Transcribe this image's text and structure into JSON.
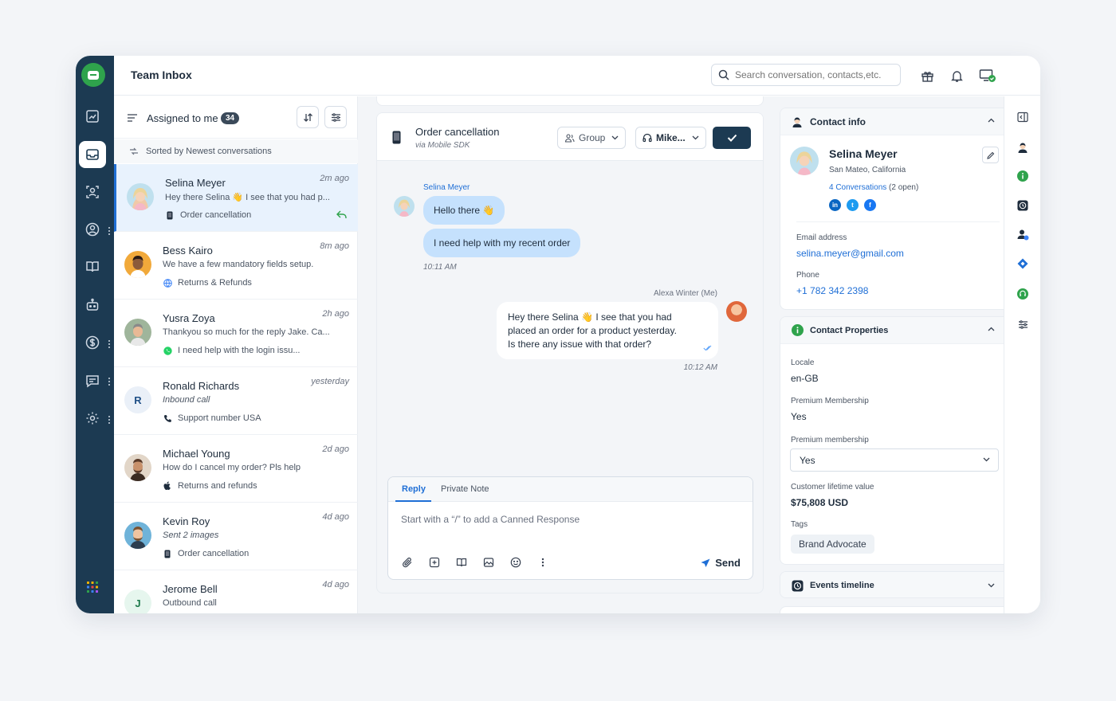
{
  "header": {
    "title": "Team Inbox",
    "search_placeholder": "Search conversation, contacts,etc."
  },
  "list": {
    "filter_label": "Assigned to me",
    "count": "34",
    "sorted_label": "Sorted by Newest conversations",
    "conversations": [
      {
        "name": "Selina Meyer",
        "time": "2m ago",
        "snippet": "Hey there Selina 👋 I see that you had p...",
        "meta": "Order cancellation",
        "meta_icon": "phone-icon",
        "active": true
      },
      {
        "name": "Bess Kairo",
        "time": "8m ago",
        "snippet": "We have a few mandatory fields setup.",
        "meta": "Returns & Refunds",
        "meta_icon": "globe-icon"
      },
      {
        "name": "Yusra Zoya",
        "time": "2h ago",
        "snippet": "Thankyou so much for the reply Jake. Ca...",
        "meta": "I need help with the login issu...",
        "meta_icon": "whatsapp-icon"
      },
      {
        "name": "Ronald Richards",
        "time": "yesterday",
        "snippet": "Inbound call",
        "meta": "Support number USA",
        "meta_icon": "call-icon",
        "initial": "R"
      },
      {
        "name": "Michael Young",
        "time": "2d ago",
        "snippet": "How do I cancel my order? Pls help",
        "meta": "Returns and refunds",
        "meta_icon": "apple-icon"
      },
      {
        "name": "Kevin Roy",
        "time": "4d ago",
        "snippet": "Sent 2 images",
        "meta": "Order cancellation",
        "meta_icon": "phone-icon"
      },
      {
        "name": "Jerome Bell",
        "time": "4d ago",
        "snippet": "Outbound call",
        "initial": "J"
      }
    ]
  },
  "chat": {
    "title": "Order cancellation",
    "subtitle": "via Mobile SDK",
    "group_label": "Group",
    "agent_label": "Mike...",
    "sender_name": "Selina Meyer",
    "msg1": "Hello there 👋",
    "msg2": "I need help with my recent order",
    "time_in": "10:11 AM",
    "me_name": "Alexa Winter (Me)",
    "reply_line1": "Hey there Selina 👋 I see that you had",
    "reply_line2": "placed an order for a product yesterday.",
    "reply_line3": "Is there any issue with that order?",
    "time_out": "10:12 AM",
    "composer": {
      "tab_reply": "Reply",
      "tab_note": "Private Note",
      "placeholder": "Start with a “/” to add a Canned Response",
      "send_label": "Send"
    }
  },
  "contact": {
    "section_title": "Contact info",
    "name": "Selina Meyer",
    "location": "San Mateo, California",
    "conversations_link": "4 Conversations",
    "conversations_open": " (2 open)",
    "social": [
      "in",
      "t",
      "f"
    ],
    "email_label": "Email address",
    "email": "selina.meyer@gmail.com",
    "phone_label": "Phone",
    "phone": "+1 782 342 2398"
  },
  "properties": {
    "section_title": "Contact Properties",
    "locale_label": "Locale",
    "locale": "en-GB",
    "premium_label": "Premium Membership",
    "premium": "Yes",
    "premium_select_label": "Premium membership",
    "premium_select_value": "Yes",
    "ltv_label": "Customer lifetime value",
    "ltv": "$75,808 USD",
    "tags_label": "Tags",
    "tag": "Brand Advocate"
  },
  "events": {
    "section_title": "Events timeline"
  },
  "colors": {
    "rail": "#1c3a52",
    "accent": "#1f6fd6",
    "bubble_in": "#c5e1fd",
    "brand_green": "#2fa34c"
  }
}
